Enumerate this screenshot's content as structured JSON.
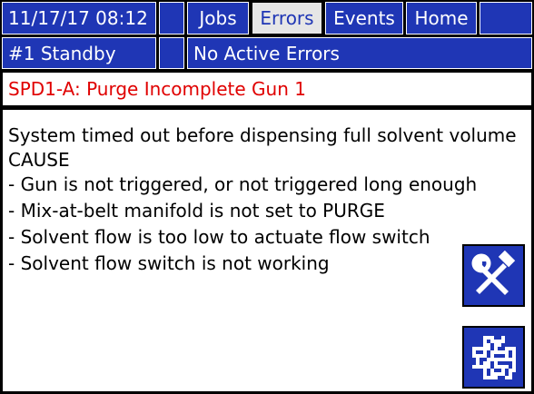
{
  "header": {
    "datetime": "11/17/17 08:12",
    "tabs": [
      {
        "label": "Jobs",
        "selected": false
      },
      {
        "label": "Errors",
        "selected": true
      },
      {
        "label": "Events",
        "selected": false
      },
      {
        "label": "Home",
        "selected": false
      }
    ],
    "status": "#1 Standby",
    "active_errors": "No Active Errors"
  },
  "error": {
    "title": "SPD1-A: Purge Incomplete Gun 1",
    "lines": [
      "System timed out before dispensing full solvent volume",
      "CAUSE",
      "- Gun is not triggered, or not triggered long enough",
      "- Mix-at-belt manifold is not set to PURGE",
      "- Solvent flow is too low to actuate flow switch",
      "- Solvent flow switch is not working"
    ]
  },
  "buttons": {
    "troubleshoot_icon": "tools-icon",
    "qr_icon": "qr-code-icon"
  },
  "colors": {
    "bar_blue": "#1f36b5",
    "error_red": "#e00000",
    "tab_selected_bg": "#e6e6e6"
  }
}
